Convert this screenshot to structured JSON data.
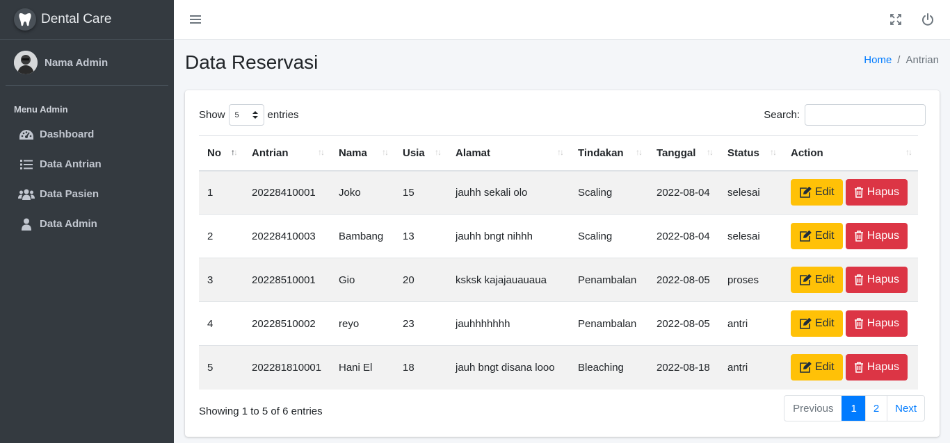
{
  "brand": {
    "name": "Dental Care"
  },
  "user": {
    "name": "Nama Admin"
  },
  "sidebar": {
    "header": "Menu Admin",
    "items": [
      {
        "label": "Dashboard",
        "icon": "dashboard-icon"
      },
      {
        "label": "Data Antrian",
        "icon": "list-icon"
      },
      {
        "label": "Data Pasien",
        "icon": "users-icon"
      },
      {
        "label": "Data Admin",
        "icon": "user-icon"
      }
    ]
  },
  "page": {
    "title": "Data Reservasi"
  },
  "breadcrumb": {
    "home": "Home",
    "separator": "/",
    "current": "Antrian"
  },
  "table_controls": {
    "show_label": "Show",
    "length_value": "5",
    "entries_label": "entries",
    "search_label": "Search:",
    "search_value": ""
  },
  "table": {
    "columns": [
      "No",
      "Antrian",
      "Nama",
      "Usia",
      "Alamat",
      "Tindakan",
      "Tanggal",
      "Status",
      "Action"
    ],
    "rows": [
      {
        "no": "1",
        "antrian": "20228410001",
        "nama": "Joko",
        "usia": "15",
        "alamat": "jauhh sekali olo",
        "tindakan": "Scaling",
        "tanggal": "2022-08-04",
        "status": "selesai"
      },
      {
        "no": "2",
        "antrian": "20228410003",
        "nama": "Bambang",
        "usia": "13",
        "alamat": "jauhh bngt nihhh",
        "tindakan": "Scaling",
        "tanggal": "2022-08-04",
        "status": "selesai"
      },
      {
        "no": "3",
        "antrian": "20228510001",
        "nama": "Gio",
        "usia": "20",
        "alamat": "ksksk kajajauauaua",
        "tindakan": "Penambalan",
        "tanggal": "2022-08-05",
        "status": "proses"
      },
      {
        "no": "4",
        "antrian": "20228510002",
        "nama": "reyo",
        "usia": "23",
        "alamat": "jauhhhhhhh",
        "tindakan": "Penambalan",
        "tanggal": "2022-08-05",
        "status": "antri"
      },
      {
        "no": "5",
        "antrian": "202281810001",
        "nama": "Hani El",
        "usia": "18",
        "alamat": "jauh bngt disana looo",
        "tindakan": "Bleaching",
        "tanggal": "2022-08-18",
        "status": "antri"
      }
    ],
    "edit_label": "Edit",
    "delete_label": "Hapus"
  },
  "footer": {
    "info": "Showing 1 to 5 of 6 entries",
    "pagination": {
      "previous": "Previous",
      "pages": [
        "1",
        "2"
      ],
      "next": "Next",
      "current": "1"
    }
  },
  "colors": {
    "sidebar": "#343a40",
    "primary": "#007bff",
    "warning": "#ffc107",
    "danger": "#dc3545"
  }
}
